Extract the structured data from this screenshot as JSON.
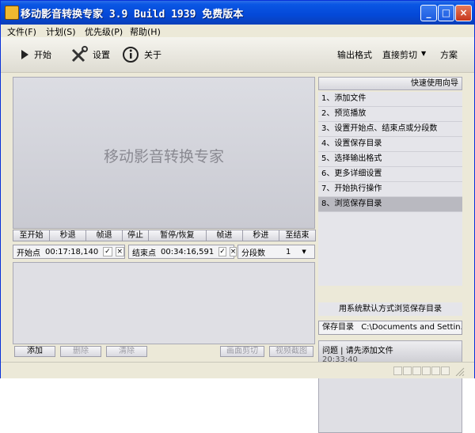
{
  "window": {
    "title": "移动影音转换专家 3.9 Build 1939 免费版本",
    "controls": {
      "minimize": "_",
      "maximize": "□",
      "close": "×"
    }
  },
  "menu": {
    "items": [
      "文件(F)",
      "计划(S)",
      "优先级(P)",
      "帮助(H)"
    ]
  },
  "toolbar": {
    "start": "开始",
    "settings": "设置",
    "about": "关于",
    "output_format": "输出格式",
    "direct_cut": "直接剪切",
    "direct_cut_arrow": "▼",
    "scheme": "方案"
  },
  "preview": {
    "label": "移动影音转换专家"
  },
  "controls": {
    "buttons": [
      "至开始",
      "秒退",
      "帧退",
      "停止",
      "暂停/恢复",
      "帧进",
      "秒进",
      "至结束"
    ]
  },
  "range": {
    "start_label": "开始点",
    "start_value": "00:17:18,140",
    "end_label": "结束点",
    "end_value": "00:34:16,591",
    "segments_label": "分段数",
    "segments_value": "1",
    "ok_glyph": "✓",
    "clear_glyph": "×",
    "dropdown_glyph": "▼"
  },
  "file_actions": {
    "add": "添加",
    "delete": "删除",
    "clear": "清除",
    "frame_cut": "画面剪切",
    "video_screenshot": "视频截图"
  },
  "guide": {
    "title": "快速使用向导",
    "steps": [
      "1、添加文件",
      "2、预览播放",
      "3、设置开始点、结束点或分段数",
      "4、设置保存目录",
      "5、选择输出格式",
      "6、更多详细设置",
      "7、开始执行操作",
      "8、浏览保存目录"
    ],
    "selected_index": 7,
    "browse_default": "用系统默认方式浏览保存目录"
  },
  "save_dir": {
    "label": "保存目录",
    "value": "C:\\Documents and Settin...\\"
  },
  "log": {
    "entry_text": "问题 | 请先添加文件",
    "entry_time": "20:33:40"
  },
  "colors": {
    "title_bar": "#0449d8",
    "selected_step": "#b9b9c0",
    "panel": "#dfdfe4"
  }
}
